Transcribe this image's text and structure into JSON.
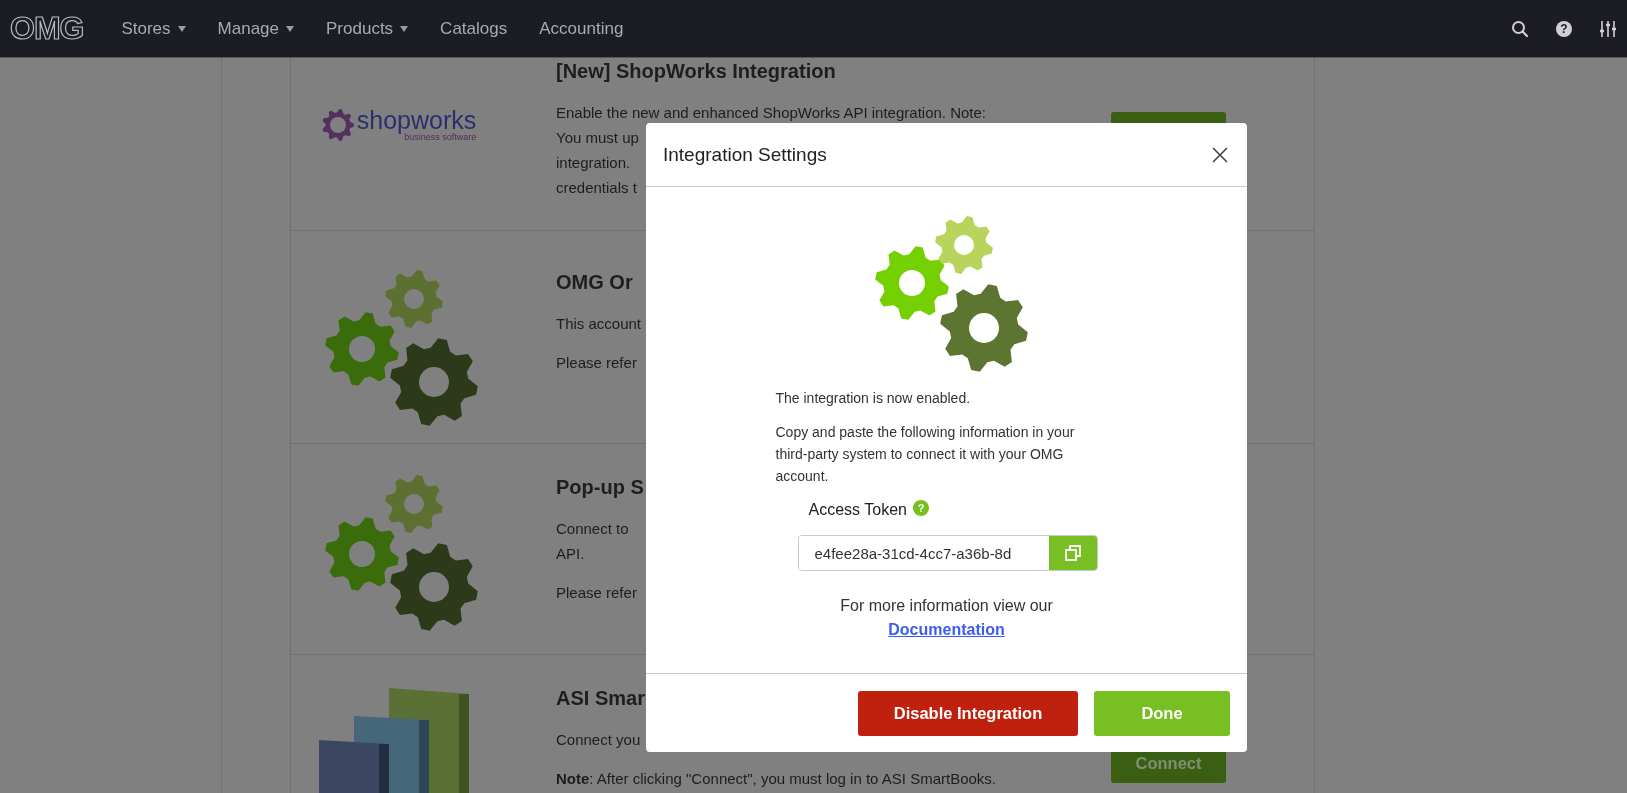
{
  "nav": {
    "logo": "OMG",
    "help_glyph": "?",
    "items": [
      {
        "label": "Stores",
        "dropdown": true
      },
      {
        "label": "Manage",
        "dropdown": true
      },
      {
        "label": "Products",
        "dropdown": true
      },
      {
        "label": "Catalogs",
        "dropdown": false
      },
      {
        "label": "Accounting",
        "dropdown": false
      }
    ]
  },
  "integrations": [
    {
      "kind": "shopworks",
      "logo_text": "shopworks",
      "logo_tagline": "business software",
      "title": "[New] ShopWorks Integration",
      "paragraphs": [
        [
          "Enable the new and enhanced ShopWorks API integration. Note:",
          "You must up",
          "integration.",
          "credentials t"
        ]
      ],
      "action_button": true
    },
    {
      "kind": "gears",
      "title": "OMG Or",
      "paragraphs": [
        [
          "This account"
        ],
        [
          "Please refer"
        ]
      ]
    },
    {
      "kind": "gears",
      "title": "Pop-up S",
      "paragraphs": [
        [
          "Connect to",
          "API."
        ],
        [
          "Please refer"
        ]
      ]
    },
    {
      "kind": "books",
      "title": "ASI Smar",
      "paragraphs": [
        [
          "Connect you"
        ],
        [
          "**Note**: After clicking \"Connect\", you must log in to ASI SmartBooks."
        ]
      ],
      "button": "Connect"
    }
  ],
  "modal": {
    "title": "Integration Settings",
    "status": "The integration is now enabled.",
    "instructions": "Copy and paste the following information in your third-party system to connect it with your OMG account.",
    "token_label": "Access Token",
    "help_glyph": "?",
    "token_value": "e4fee28a-31cd-4cc7-a36b-8d",
    "more_info": "For more information view our",
    "link": "Documentation",
    "buttons": [
      {
        "label": "Disable Integration",
        "kind": "danger"
      },
      {
        "label": "Done",
        "kind": "primary"
      }
    ]
  }
}
